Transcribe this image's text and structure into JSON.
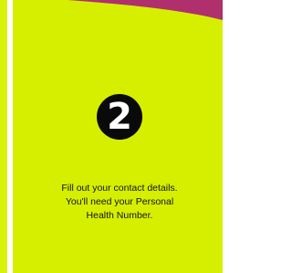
{
  "step": {
    "number": "2",
    "lines": [
      "Fill out your contact details.",
      "You'll need your Personal",
      "Health Number."
    ]
  },
  "colors": {
    "card_background": "#d6ef00",
    "accent_wave": "#b0306e",
    "circle": "#0a0a0a",
    "circle_text": "#ffffff"
  }
}
